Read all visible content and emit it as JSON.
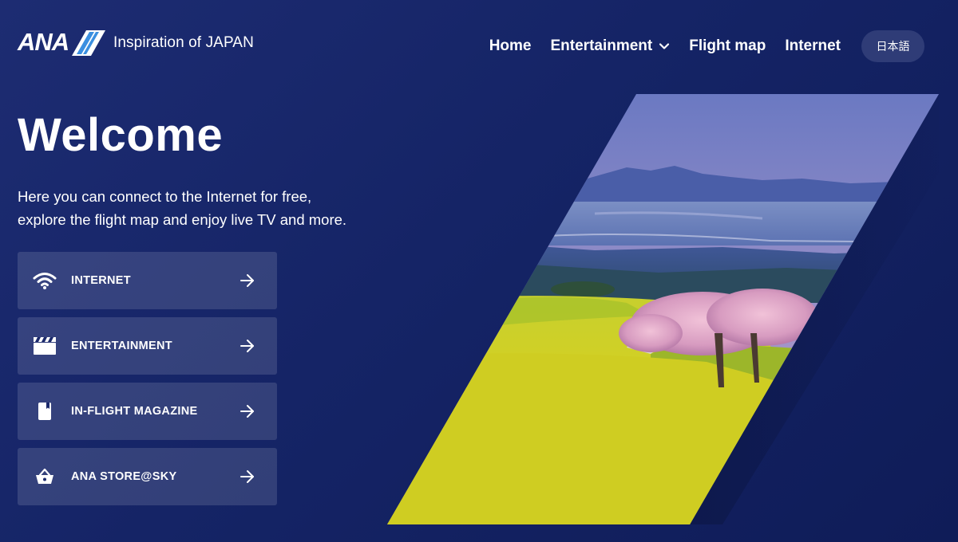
{
  "header": {
    "logo_text": "ANA",
    "tagline": "Inspiration of JAPAN",
    "nav": [
      {
        "label": "Home"
      },
      {
        "label": "Entertainment"
      },
      {
        "label": "Flight map"
      },
      {
        "label": "Internet"
      }
    ],
    "language_button": "日本語"
  },
  "hero": {
    "title": "Welcome",
    "intro_line1": "Here you can connect to the Internet for free,",
    "intro_line2": "explore the flight map and enjoy live TV and more."
  },
  "menu": [
    {
      "label": "INTERNET",
      "icon": "wifi-icon"
    },
    {
      "label": "ENTERTAINMENT",
      "icon": "clapperboard-icon"
    },
    {
      "label": "IN-FLIGHT MAGAZINE",
      "icon": "book-icon"
    },
    {
      "label": "ANA STORE@SKY",
      "icon": "shopping-basket-icon"
    }
  ],
  "colors": {
    "background": "#152466",
    "button_bg": "rgba(255,255,255,0.13)",
    "lang_button_bg": "#2f3c77",
    "logo_blue": "#3b8fe0"
  }
}
